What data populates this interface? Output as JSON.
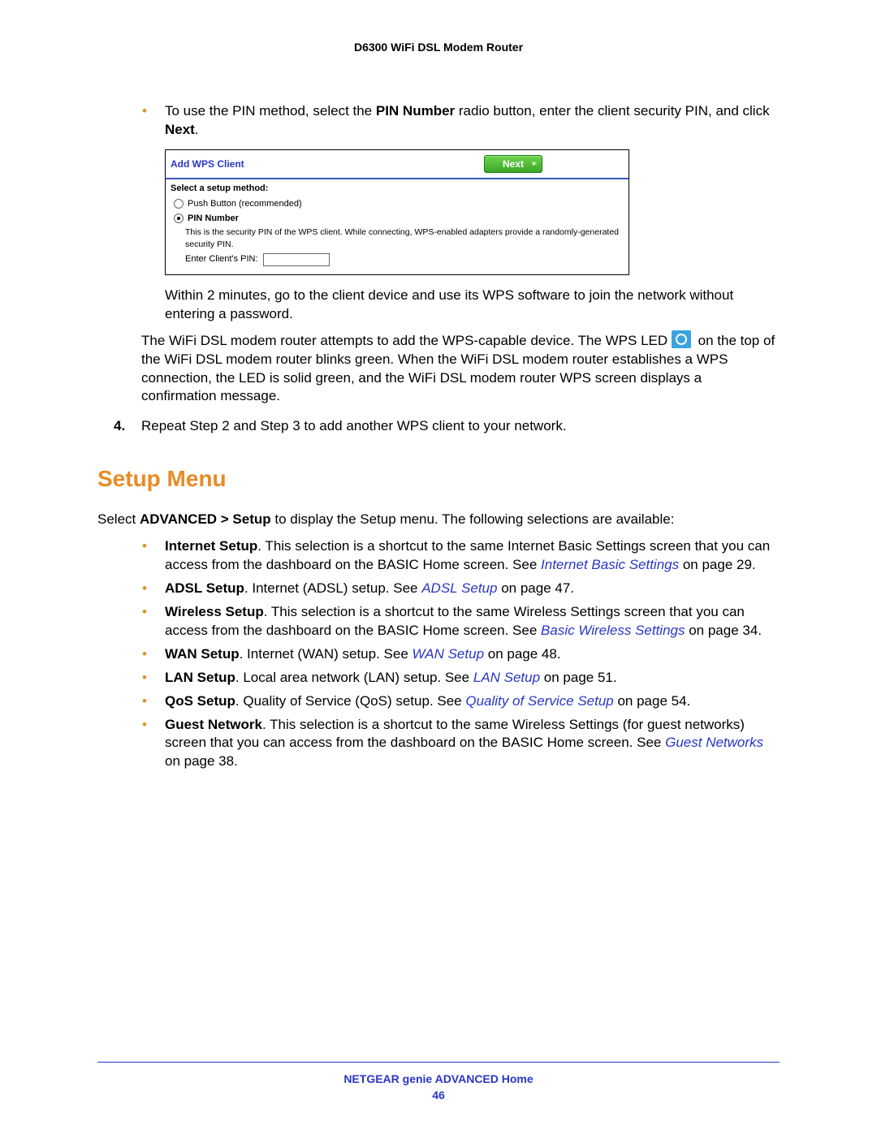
{
  "header": {
    "title": "D6300 WiFi DSL Modem Router"
  },
  "sec1": {
    "bullet1_pre": "To use the PIN method, select the ",
    "bullet1_b1": "PIN Number",
    "bullet1_mid": " radio button, enter the client security PIN, and click ",
    "bullet1_b2": "Next",
    "bullet1_post": "."
  },
  "panel": {
    "title": "Add WPS Client",
    "next": "Next",
    "select": "Select a setup method:",
    "push": "Push Button (recommended)",
    "pin": "PIN Number",
    "note": "This is the security PIN of the WPS client. While connecting, WPS-enabled adapters provide a randomly-generated security PIN.",
    "enter": "Enter Client's PIN:"
  },
  "after_panel": {
    "p1": "Within 2 minutes, go to the client device and use its WPS software to join the network without entering a password.",
    "p2a": "The WiFi DSL modem router attempts to add the WPS-capable device. The WPS LED",
    "p2b": "on the top of the WiFi DSL modem router blinks green. When the WiFi DSL modem router establishes a WPS connection, the LED is solid green, and the WiFi DSL modem router WPS screen displays a confirmation message."
  },
  "step4": {
    "num": "4.",
    "text": "Repeat Step 2 and Step 3 to add another WPS client to your network."
  },
  "h2": "Setup Menu",
  "intro_pre": "Select ",
  "intro_b": "ADVANCED > Setup",
  "intro_post": " to display the Setup menu. The following selections are available:",
  "items": {
    "internet": {
      "b": "Internet Setup",
      "t1": ". This selection is a shortcut to the same Internet Basic Settings screen that you can access from the dashboard on the BASIC Home screen. See ",
      "link": "Internet Basic Settings",
      "t2": " on page 29."
    },
    "adsl": {
      "b": "ADSL Setup",
      "t1": ". Internet (ADSL) setup. See ",
      "link": "ADSL Setup",
      "t2": " on page 47."
    },
    "wireless": {
      "b": "Wireless Setup",
      "t1": ". This selection is a shortcut to the same Wireless Settings screen that you can access from the dashboard on the BASIC Home screen. See ",
      "link": "Basic Wireless Settings",
      "t2": " on page 34."
    },
    "wan": {
      "b": "WAN Setup",
      "t1": ". Internet (WAN) setup. See ",
      "link": "WAN Setup",
      "t2": " on page 48."
    },
    "lan": {
      "b": "LAN Setup",
      "t1": ". Local area network (LAN) setup. See ",
      "link": "LAN Setup",
      "t2": " on page 51."
    },
    "qos": {
      "b": "QoS Setup",
      "t1": ". Quality of Service (QoS) setup. See ",
      "link": "Quality of Service Setup",
      "t2": " on page 54."
    },
    "guest": {
      "b": "Guest Network",
      "t1": ". This selection is a shortcut to the same Wireless Settings (for guest networks) screen that you can access from the dashboard on the BASIC Home screen. See ",
      "link": "Guest Networks",
      "t2": " on page 38."
    }
  },
  "footer": {
    "text": "NETGEAR genie ADVANCED Home",
    "page": "46"
  }
}
